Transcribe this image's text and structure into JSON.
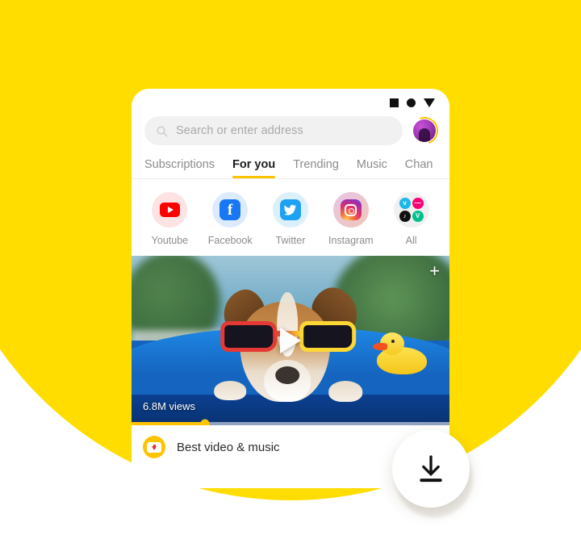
{
  "theme": {
    "background_color": "#FFDD00",
    "accent_color": "#FFC400",
    "card_color": "#FFFFFF"
  },
  "statusbar": {
    "nav_buttons": [
      {
        "icon": "square-icon",
        "label": "Recents"
      },
      {
        "icon": "circle-icon",
        "label": "Home"
      },
      {
        "icon": "triangle-down-icon",
        "label": "Back"
      }
    ]
  },
  "search": {
    "icon": "search-icon",
    "placeholder": "Search or enter address",
    "value": ""
  },
  "account": {
    "avatar_icon": "avatar",
    "ring_color": "#FFC400"
  },
  "tabs": {
    "items": [
      {
        "label": "Subscriptions",
        "active": false
      },
      {
        "label": "For you",
        "active": true
      },
      {
        "label": "Trending",
        "active": false
      },
      {
        "label": "Music",
        "active": false
      },
      {
        "label": "Chan",
        "active": false
      }
    ]
  },
  "shortcuts": [
    {
      "label": "Youtube",
      "icon": "youtube-icon",
      "color": "#FF0000"
    },
    {
      "label": "Facebook",
      "icon": "facebook-icon",
      "color": "#1877F2"
    },
    {
      "label": "Twitter",
      "icon": "twitter-icon",
      "color": "#1DA1F2"
    },
    {
      "label": "Instagram",
      "icon": "instagram-icon",
      "color": "#E1306C"
    },
    {
      "label": "All",
      "icon": "all-apps-icon",
      "color": "#F0F0F0",
      "mini_icons": [
        {
          "name": "vimeo-icon",
          "glyph": "v",
          "color": "#1AB7EA"
        },
        {
          "name": "dailymotion-icon",
          "glyph": "—",
          "color": "#FF0074"
        },
        {
          "name": "tiktok-icon",
          "glyph": "♪",
          "color": "#111111"
        },
        {
          "name": "vine-icon",
          "glyph": "V",
          "color": "#00C08B"
        }
      ]
    }
  ],
  "video": {
    "description": "Dog wearing sunglasses floating in a pool with a rubber duck",
    "views": "6.8M views",
    "play_icon": "play-icon",
    "add_icon": "plus-icon",
    "progress_percent": 23
  },
  "bottombar": {
    "badge_icon": "download-badge-icon",
    "title": "Best video & music"
  },
  "fab": {
    "icon": "download-icon",
    "label": "Download"
  }
}
